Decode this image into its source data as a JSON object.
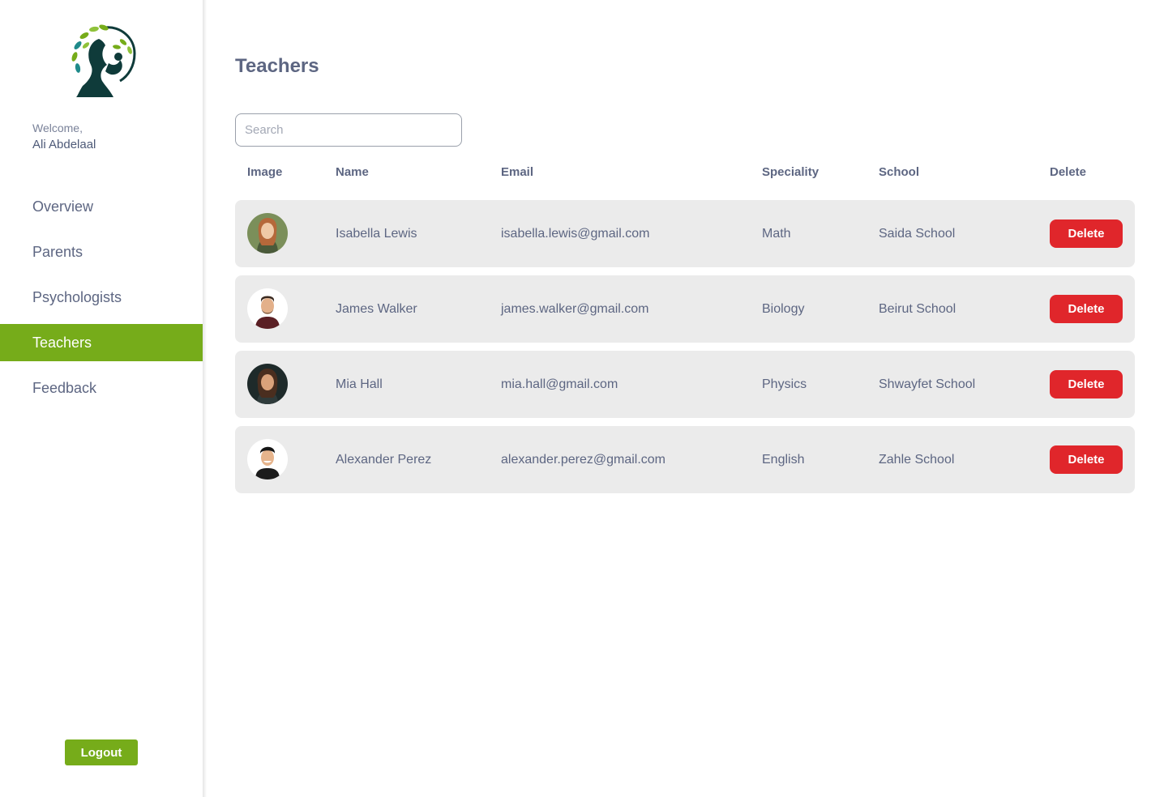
{
  "sidebar": {
    "logo_icon": "tree-woman-logo-icon",
    "welcome": "Welcome,",
    "user_name": "Ali Abdelaal",
    "items": [
      {
        "label": "Overview",
        "active": false
      },
      {
        "label": "Parents",
        "active": false
      },
      {
        "label": "Psychologists",
        "active": false
      },
      {
        "label": "Teachers",
        "active": true
      },
      {
        "label": "Feedback",
        "active": false
      }
    ],
    "logout_label": "Logout"
  },
  "main": {
    "title": "Teachers",
    "search": {
      "placeholder": "Search",
      "value": ""
    },
    "columns": [
      "Image",
      "Name",
      "Email",
      "Speciality",
      "School",
      "Delete"
    ],
    "rows": [
      {
        "name": "Isabella Lewis",
        "email": "isabella.lewis@gmail.com",
        "speciality": "Math",
        "school": "Saida School",
        "delete_label": "Delete"
      },
      {
        "name": "James Walker",
        "email": "james.walker@gmail.com",
        "speciality": "Biology",
        "school": "Beirut School",
        "delete_label": "Delete"
      },
      {
        "name": "Mia Hall",
        "email": "mia.hall@gmail.com",
        "speciality": "Physics",
        "school": "Shwayfet School",
        "delete_label": "Delete"
      },
      {
        "name": "Alexander Perez",
        "email": "alexander.perez@gmail.com",
        "speciality": "English",
        "school": "Zahle School",
        "delete_label": "Delete"
      }
    ]
  },
  "colors": {
    "accent": "#76ac1a",
    "danger": "#e0262b",
    "text": "#5d6682",
    "row_bg": "#ebebeb"
  }
}
